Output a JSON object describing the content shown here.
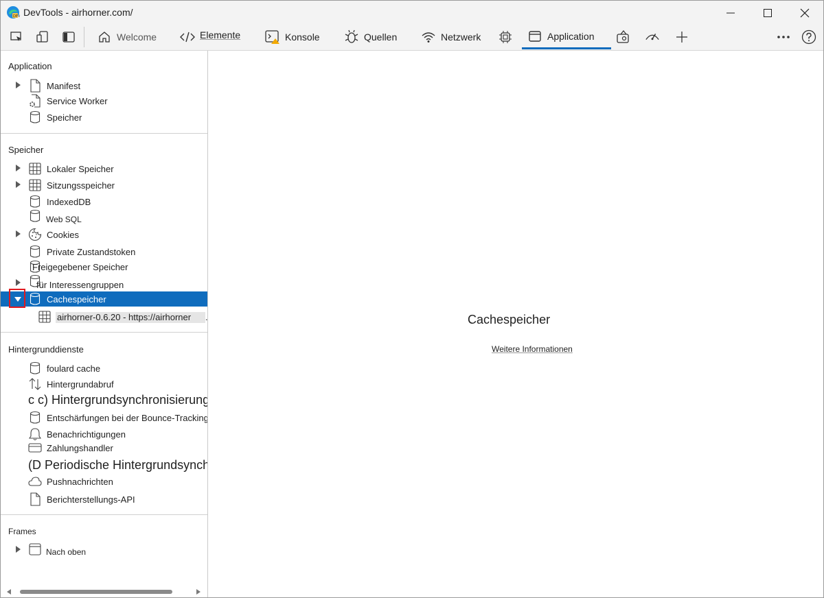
{
  "window": {
    "title": "DevTools - airhorner.com/"
  },
  "toolbar": {
    "tabs": [
      {
        "label": "Welcome",
        "icon": "home-icon"
      },
      {
        "label": "Elemente",
        "icon": "code-icon"
      },
      {
        "label": "Konsole",
        "icon": "console-warning-icon"
      },
      {
        "label": "Quellen",
        "icon": "bug-icon"
      },
      {
        "label": "Netzwerk",
        "icon": "wifi-icon"
      },
      {
        "label": "",
        "icon": "cpu-icon"
      },
      {
        "label": "Application",
        "icon": "application-icon"
      },
      {
        "label": "",
        "icon": "paint-icon"
      },
      {
        "label": "",
        "icon": "performance-icon"
      }
    ],
    "active_tab": "Application"
  },
  "sidebar": {
    "application": {
      "header": "Application",
      "items": [
        "Manifest",
        "Service Worker",
        "Speicher"
      ]
    },
    "storage": {
      "header": "Speicher",
      "items": [
        "Lokaler Speicher",
        "Sitzungsspeicher",
        "IndexedDB",
        "Web SQL",
        "Cookies",
        "Private Zustandstoken",
        "Freigegebener Speicher",
        "für Interessengruppen",
        "Cachespeicher"
      ],
      "cache_entry": "airhorner-0.6.20 - https://airhorner",
      "cache_entry_ellipsis": "."
    },
    "background": {
      "header": "Hintergrunddienste",
      "items": [
        "foulard cache",
        "Hintergrundabruf",
        "c c) Hintergrundsynchronisierung",
        "Entschärfungen bei der Bounce-Tracking-Überwachung",
        "Benachrichtigungen",
        "Zahlungshandler",
        "(D Periodische Hintergrundsynchronisierung",
        "Pushnachrichten",
        "Berichterstellungs-API"
      ]
    },
    "frames": {
      "header": "Frames",
      "items": [
        "Nach oben"
      ]
    }
  },
  "main": {
    "title": "Cachespeicher",
    "link": "Weitere Informationen"
  },
  "colors": {
    "accent": "#0f6cbd",
    "highlight_box": "#e0191f",
    "toolbar_bg": "#f3f3f3"
  }
}
